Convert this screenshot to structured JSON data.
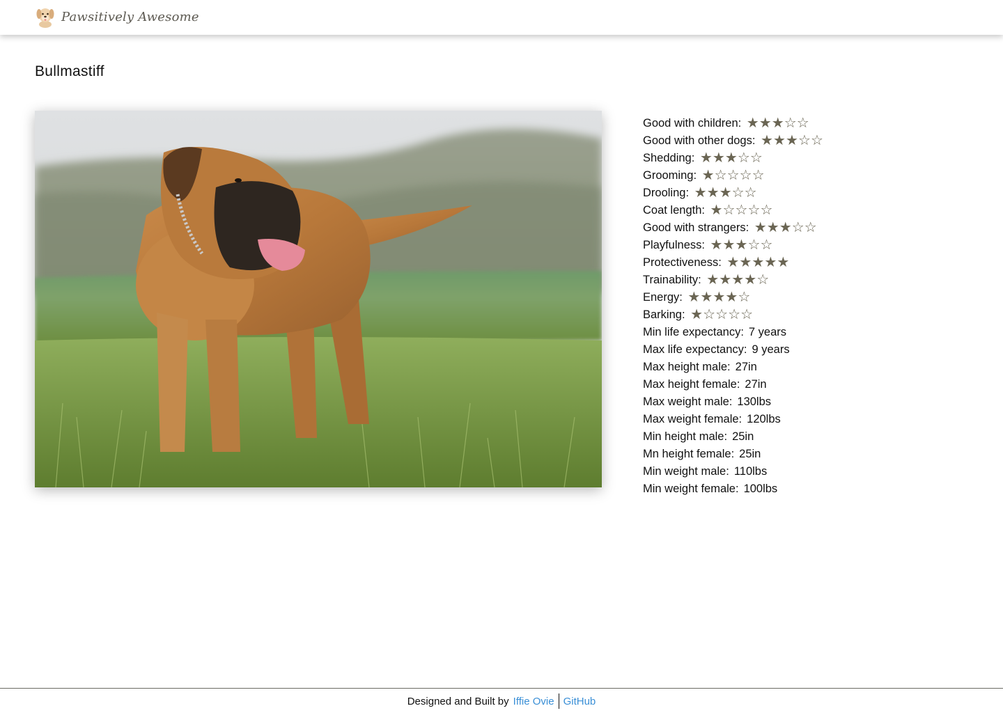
{
  "header": {
    "brand_name": "Pawsitively Awesome",
    "logo_icon": "dog-face-icon"
  },
  "breed": {
    "name": "Bullmastiff",
    "image_alt": "Bullmastiff"
  },
  "traits": [
    {
      "label": "Good with children:",
      "rating": 3,
      "max": 5
    },
    {
      "label": "Good with other dogs:",
      "rating": 3,
      "max": 5
    },
    {
      "label": "Shedding:",
      "rating": 3,
      "max": 5
    },
    {
      "label": "Grooming:",
      "rating": 1,
      "max": 5
    },
    {
      "label": "Drooling:",
      "rating": 3,
      "max": 5
    },
    {
      "label": "Coat length:",
      "rating": 1,
      "max": 5
    },
    {
      "label": "Good with strangers:",
      "rating": 3,
      "max": 5
    },
    {
      "label": "Playfulness:",
      "rating": 3,
      "max": 5
    },
    {
      "label": "Protectiveness:",
      "rating": 5,
      "max": 5
    },
    {
      "label": "Trainability:",
      "rating": 4,
      "max": 5
    },
    {
      "label": "Energy:",
      "rating": 4,
      "max": 5
    },
    {
      "label": "Barking:",
      "rating": 1,
      "max": 5
    },
    {
      "label": "Min life expectancy:",
      "value": "7 years"
    },
    {
      "label": "Max life expectancy:",
      "value": "9 years"
    },
    {
      "label": "Max height male:",
      "value": "27in"
    },
    {
      "label": "Max height female:",
      "value": "27in"
    },
    {
      "label": "Max weight male:",
      "value": "130lbs"
    },
    {
      "label": "Max weight female:",
      "value": "120lbs"
    },
    {
      "label": "Min height male:",
      "value": "25in"
    },
    {
      "label": "Mn height female:",
      "value": "25in"
    },
    {
      "label": "Min weight male:",
      "value": "110lbs"
    },
    {
      "label": "Min weight female:",
      "value": "100lbs"
    }
  ],
  "footer": {
    "credit_text": "Designed and Built by",
    "author_link": "Iffie Ovie",
    "github_link": "GitHub"
  },
  "colors": {
    "star": "#6a6553",
    "link": "#3a8fd6",
    "brand": "#5d5a52"
  }
}
